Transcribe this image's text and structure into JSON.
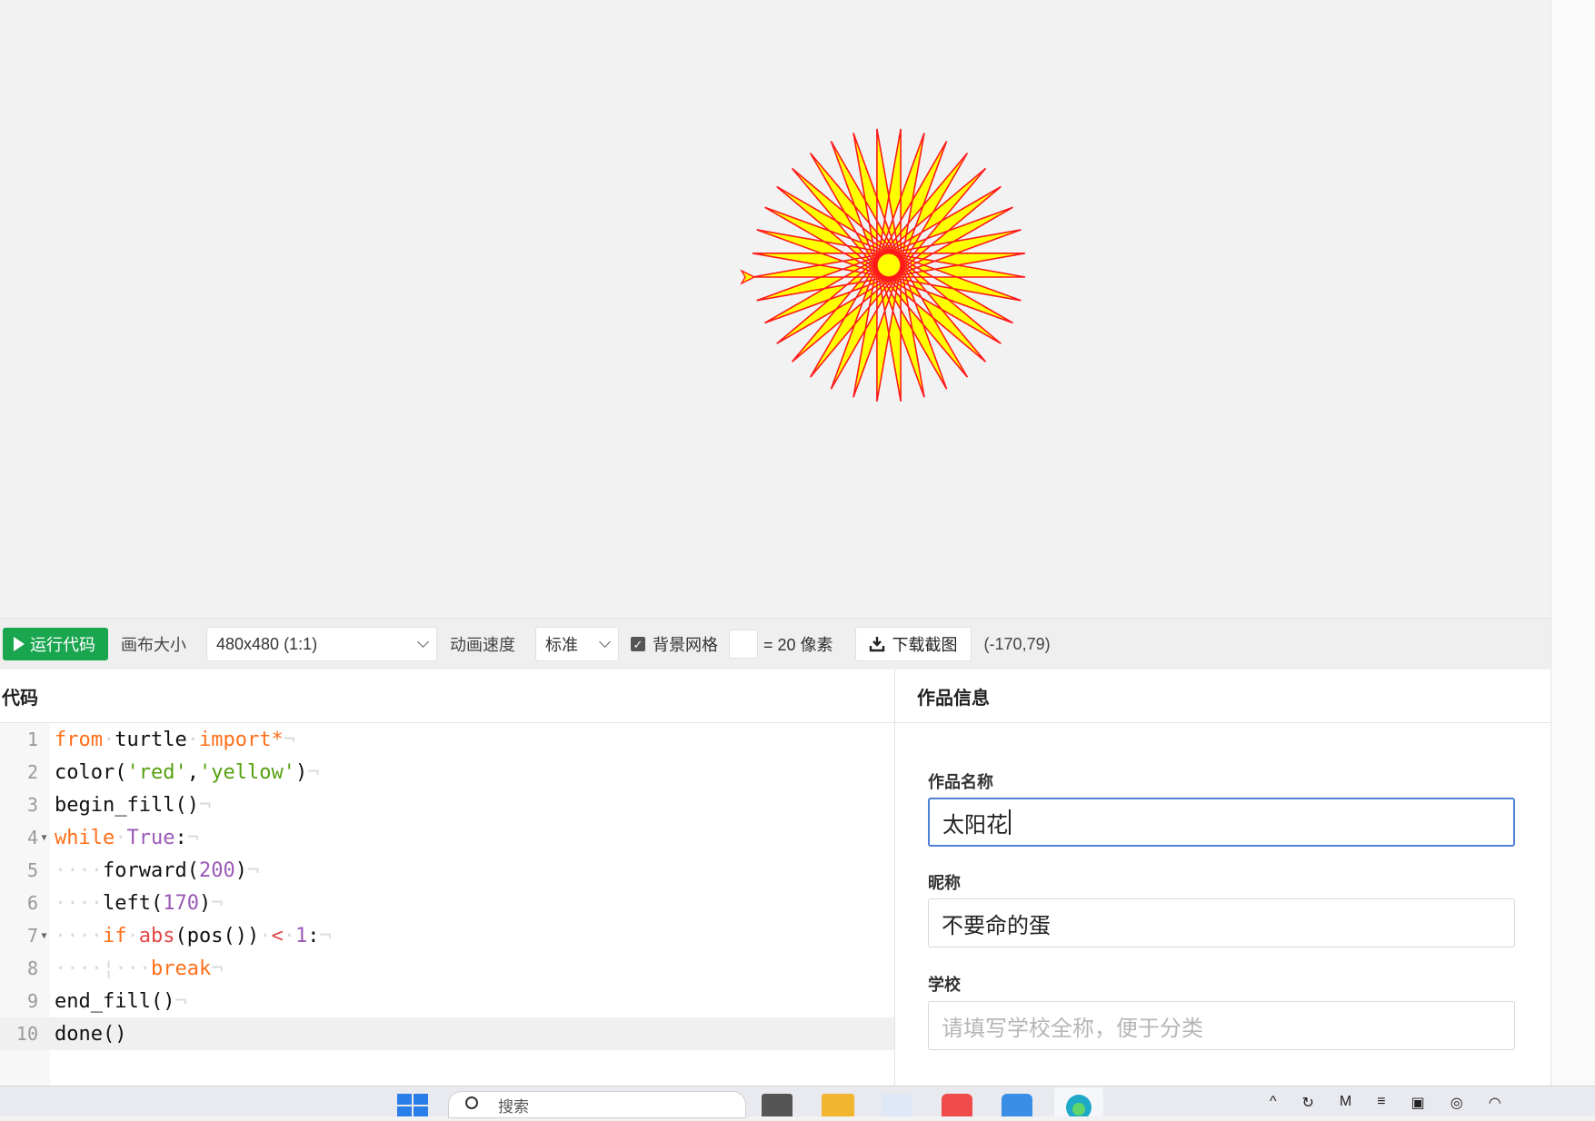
{
  "toolbar": {
    "run_label": "运行代码",
    "canvas_size_label": "画布大小",
    "canvas_size_value": "480x480 (1:1)",
    "speed_label": "动画速度",
    "speed_value": "标准",
    "grid_label": "背景网格",
    "grid_checked": true,
    "grid_suffix": "= 20 像素",
    "download_label": "下载截图",
    "coords": "(-170,79)"
  },
  "code": {
    "title": "代码",
    "line_numbers": [
      "1",
      "2",
      "3",
      "4",
      "5",
      "6",
      "7",
      "8",
      "9",
      "10"
    ]
  },
  "info": {
    "title": "作品信息",
    "name_label": "作品名称",
    "name_value": "太阳花",
    "nickname_label": "昵称",
    "nickname_value": "不要命的蛋",
    "school_label": "学校",
    "school_placeholder": "请填写学校全称，便于分类"
  },
  "taskbar": {
    "search_placeholder": "搜索"
  },
  "colors": {
    "run_button": "#1aa54f",
    "star_stroke": "#ff1a1a",
    "star_fill": "#ffff00",
    "focus_border": "#4f7fd6"
  }
}
